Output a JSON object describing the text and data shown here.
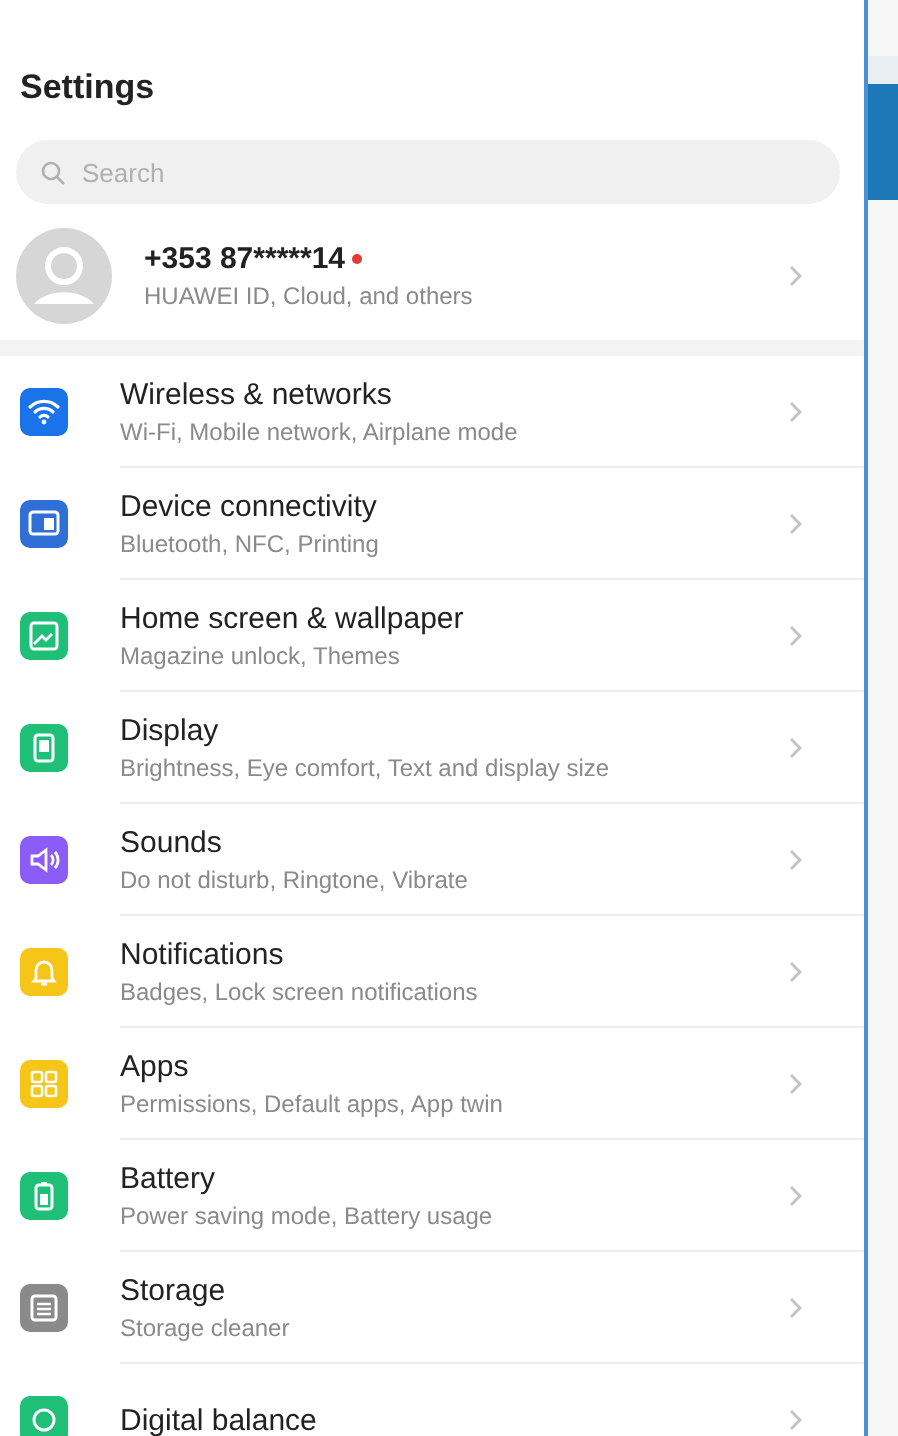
{
  "header": {
    "title": "Settings"
  },
  "search": {
    "placeholder": "Search"
  },
  "account": {
    "name": "+353 87*****14",
    "subtitle": "HUAWEI ID, Cloud, and others",
    "unread": true
  },
  "items": [
    {
      "kind": "wifi",
      "color": "#1a73e8",
      "title": "Wireless & networks",
      "subtitle": "Wi-Fi, Mobile network, Airplane mode"
    },
    {
      "kind": "devices",
      "color": "#2f6fd6",
      "title": "Device connectivity",
      "subtitle": "Bluetooth, NFC, Printing"
    },
    {
      "kind": "wallpaper",
      "color": "#1fbf78",
      "title": "Home screen & wallpaper",
      "subtitle": "Magazine unlock, Themes"
    },
    {
      "kind": "display",
      "color": "#1fbf78",
      "title": "Display",
      "subtitle": "Brightness, Eye comfort, Text and display size"
    },
    {
      "kind": "sound",
      "color": "#8b5cf6",
      "title": "Sounds",
      "subtitle": "Do not disturb, Ringtone, Vibrate"
    },
    {
      "kind": "bell",
      "color": "#f5c518",
      "title": "Notifications",
      "subtitle": "Badges, Lock screen notifications"
    },
    {
      "kind": "apps",
      "color": "#f5c518",
      "title": "Apps",
      "subtitle": "Permissions, Default apps, App twin"
    },
    {
      "kind": "battery",
      "color": "#1fbf78",
      "title": "Battery",
      "subtitle": "Power saving mode, Battery usage"
    },
    {
      "kind": "storage",
      "color": "#8a8a8a",
      "title": "Storage",
      "subtitle": "Storage cleaner"
    },
    {
      "kind": "balance",
      "color": "#1fbf78",
      "title": "Digital balance"
    }
  ]
}
